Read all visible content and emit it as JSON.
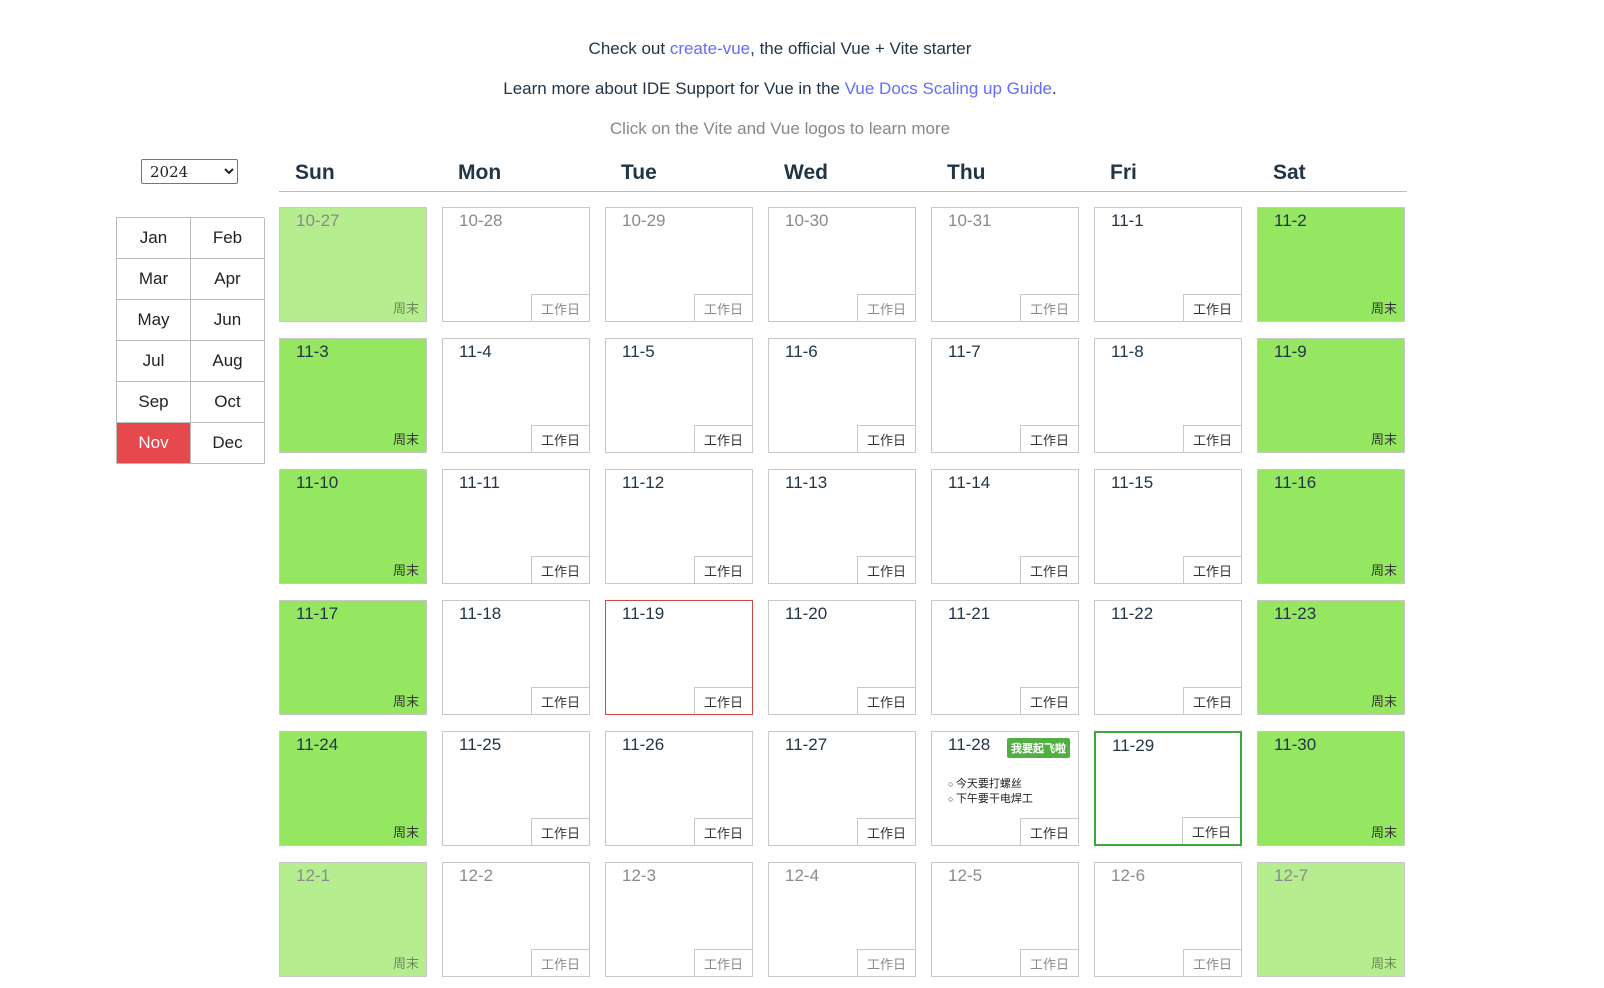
{
  "intro": {
    "line1_prefix": "Check out ",
    "line1_link": "create-vue",
    "line1_suffix": ", the official Vue + Vite starter",
    "line2_prefix": "Learn more about IDE Support for Vue in the ",
    "line2_link": "Vue Docs Scaling up Guide",
    "line2_suffix": ".",
    "line3": "Click on the Vite and Vue logos to learn more"
  },
  "year_select": {
    "value": "2024"
  },
  "months": [
    "Jan",
    "Feb",
    "Mar",
    "Apr",
    "May",
    "Jun",
    "Jul",
    "Aug",
    "Sep",
    "Oct",
    "Nov",
    "Dec"
  ],
  "selected_month": "Nov",
  "weekdays": [
    "Sun",
    "Mon",
    "Tue",
    "Wed",
    "Thu",
    "Fri",
    "Sat"
  ],
  "labels": {
    "workday": "工作日",
    "weekend": "周末"
  },
  "days": [
    {
      "date": "10-27",
      "type": "weekend",
      "other": true
    },
    {
      "date": "10-28",
      "type": "workday",
      "other": true
    },
    {
      "date": "10-29",
      "type": "workday",
      "other": true
    },
    {
      "date": "10-30",
      "type": "workday",
      "other": true
    },
    {
      "date": "10-31",
      "type": "workday",
      "other": true
    },
    {
      "date": "11-1",
      "type": "workday"
    },
    {
      "date": "11-2",
      "type": "weekend"
    },
    {
      "date": "11-3",
      "type": "weekend"
    },
    {
      "date": "11-4",
      "type": "workday"
    },
    {
      "date": "11-5",
      "type": "workday"
    },
    {
      "date": "11-6",
      "type": "workday"
    },
    {
      "date": "11-7",
      "type": "workday"
    },
    {
      "date": "11-8",
      "type": "workday"
    },
    {
      "date": "11-9",
      "type": "weekend"
    },
    {
      "date": "11-10",
      "type": "weekend"
    },
    {
      "date": "11-11",
      "type": "workday"
    },
    {
      "date": "11-12",
      "type": "workday"
    },
    {
      "date": "11-13",
      "type": "workday"
    },
    {
      "date": "11-14",
      "type": "workday"
    },
    {
      "date": "11-15",
      "type": "workday"
    },
    {
      "date": "11-16",
      "type": "weekend"
    },
    {
      "date": "11-17",
      "type": "weekend"
    },
    {
      "date": "11-18",
      "type": "workday"
    },
    {
      "date": "11-19",
      "type": "workday",
      "today": true
    },
    {
      "date": "11-20",
      "type": "workday"
    },
    {
      "date": "11-21",
      "type": "workday"
    },
    {
      "date": "11-22",
      "type": "workday"
    },
    {
      "date": "11-23",
      "type": "weekend"
    },
    {
      "date": "11-24",
      "type": "weekend"
    },
    {
      "date": "11-25",
      "type": "workday"
    },
    {
      "date": "11-26",
      "type": "workday"
    },
    {
      "date": "11-27",
      "type": "workday"
    },
    {
      "date": "11-28",
      "type": "workday",
      "badge": "我要起飞啦",
      "events": [
        "今天要打螺丝",
        "下午要干电焊工"
      ]
    },
    {
      "date": "11-29",
      "type": "workday",
      "selected": true
    },
    {
      "date": "11-30",
      "type": "weekend"
    },
    {
      "date": "12-1",
      "type": "weekend",
      "other": true
    },
    {
      "date": "12-2",
      "type": "workday",
      "other": true
    },
    {
      "date": "12-3",
      "type": "workday",
      "other": true
    },
    {
      "date": "12-4",
      "type": "workday",
      "other": true
    },
    {
      "date": "12-5",
      "type": "workday",
      "other": true
    },
    {
      "date": "12-6",
      "type": "workday",
      "other": true
    },
    {
      "date": "12-7",
      "type": "weekend",
      "other": true
    }
  ],
  "colors": {
    "weekend": "#95e660",
    "weekend_other_month": "#b6ee8f",
    "today_border": "#d64545",
    "selected_border": "#3aa83a",
    "selected_month": "#e5484d",
    "link": "#646cff",
    "badge": "#52b043"
  }
}
